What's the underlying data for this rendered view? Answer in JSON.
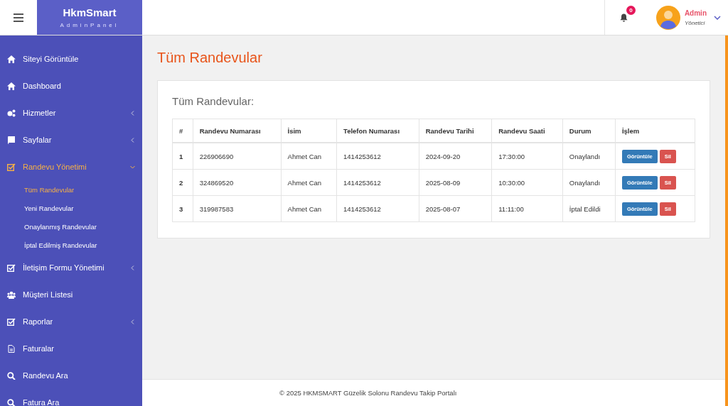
{
  "brand": {
    "title": "HkmSmart",
    "subtitle": "AdminPanel"
  },
  "header": {
    "notifications": "0",
    "user_name": "Admin",
    "user_role": "Yönetici"
  },
  "sidebar": {
    "items": [
      {
        "label": "Siteyi Görüntüle",
        "selected": false
      },
      {
        "label": "Dashboard",
        "selected": false
      },
      {
        "label": "Hizmetler",
        "selected": false,
        "expanded": false
      },
      {
        "label": "Sayfalar",
        "selected": false,
        "expanded": false
      },
      {
        "label": "Randevu Yönetimi",
        "selected": true,
        "expanded": true,
        "children": [
          {
            "label": "Tüm Randevular",
            "selected": true
          },
          {
            "label": "Yeni Randevular",
            "selected": false
          },
          {
            "label": "Onaylanmış Randevular",
            "selected": false
          },
          {
            "label": "İptal Edilmiş Randevular",
            "selected": false
          }
        ]
      },
      {
        "label": "İletişim Formu Yönetimi",
        "selected": false,
        "expanded": false
      },
      {
        "label": "Müşteri Listesi",
        "selected": false
      },
      {
        "label": "Raporlar",
        "selected": false,
        "expanded": false
      },
      {
        "label": "Faturalar",
        "selected": false
      },
      {
        "label": "Randevu Ara",
        "selected": false
      },
      {
        "label": "Fatura Ara",
        "selected": false
      }
    ]
  },
  "page_title": "Tüm Randevular",
  "card": {
    "title": "Tüm Randevular:",
    "table": {
      "columns": [
        "#",
        "Randevu Numarası",
        "İsim",
        "Telefon Numarası",
        "Randevu Tarihi",
        "Randevu Saati",
        "Durum",
        "İşlem"
      ],
      "rows": [
        {
          "cells": [
            "1",
            "226906690",
            "Ahmet Can",
            "1414253612",
            "2024-09-20",
            "17:30:00",
            "Onaylandı"
          ],
          "actions": [
            "Görüntüle",
            "Sil"
          ]
        },
        {
          "cells": [
            "2",
            "324869520",
            "Ahmet Can",
            "1414253612",
            "2025-08-09",
            "10:30:00",
            "Onaylandı"
          ],
          "actions": [
            "Görüntüle",
            "Sil"
          ]
        },
        {
          "cells": [
            "3",
            "319987583",
            "Ahmet Can",
            "1414253612",
            "2025-08-07",
            "11:11:00",
            "İptal Edildi"
          ],
          "actions": [
            "Görüntüle",
            "Sil"
          ]
        }
      ]
    }
  },
  "footer": "© 2025 HKMSMART Güzelik Solonu Randevu Takip Portalı"
}
